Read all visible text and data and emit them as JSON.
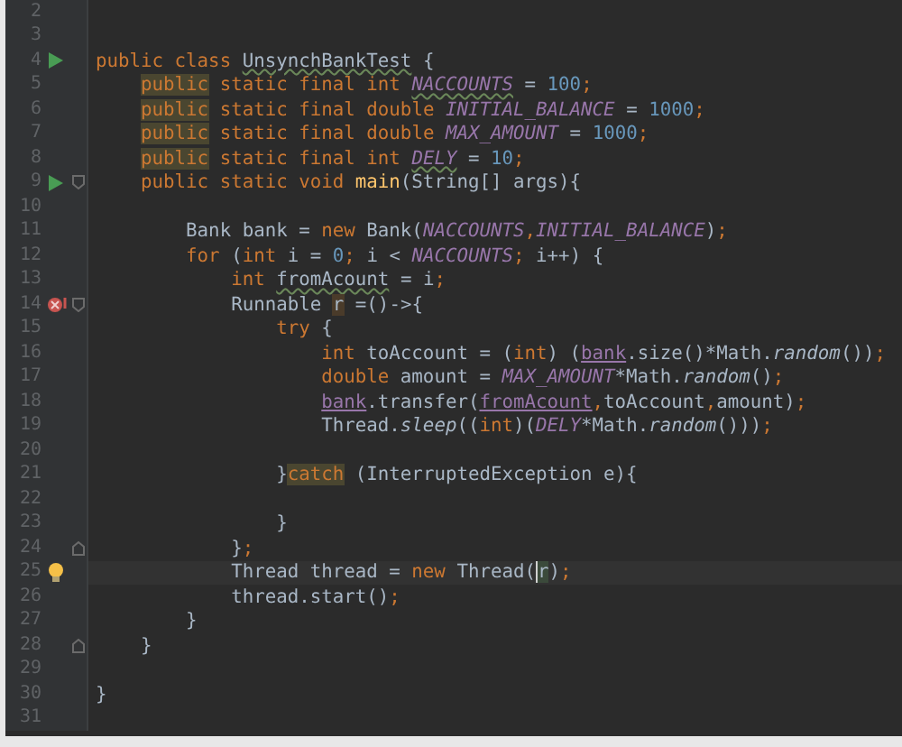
{
  "editor": {
    "lines": [
      {
        "number": "2"
      },
      {
        "number": "3"
      },
      {
        "number": "4",
        "gutter_icon": {
          "kind": "run"
        },
        "tokens": [
          {
            "text": "public class ",
            "kind": "keyword"
          },
          {
            "text": "UnsynchBankTest",
            "kind": "typo"
          },
          {
            "text": " {",
            "kind": "plain"
          }
        ]
      },
      {
        "number": "5",
        "tokens": [
          {
            "text": "    public",
            "kind": "keyword-highlight"
          },
          {
            "text": " static final int ",
            "kind": "keyword"
          },
          {
            "text": "NACCOUNTS",
            "kind": "constant-typo"
          },
          {
            "text": " = ",
            "kind": "plain"
          },
          {
            "text": "100",
            "kind": "number"
          },
          {
            "text": ";",
            "kind": "keyword"
          }
        ]
      },
      {
        "number": "6",
        "tokens": [
          {
            "text": "    public",
            "kind": "keyword-highlight"
          },
          {
            "text": " static final double ",
            "kind": "keyword"
          },
          {
            "text": "INITIAL_BALANCE",
            "kind": "constant"
          },
          {
            "text": " = ",
            "kind": "plain"
          },
          {
            "text": "1000",
            "kind": "number"
          },
          {
            "text": ";",
            "kind": "keyword"
          }
        ]
      },
      {
        "number": "7",
        "tokens": [
          {
            "text": "    public",
            "kind": "keyword-highlight"
          },
          {
            "text": " static final double ",
            "kind": "keyword"
          },
          {
            "text": "MAX_AMOUNT",
            "kind": "constant"
          },
          {
            "text": " = ",
            "kind": "plain"
          },
          {
            "text": "1000",
            "kind": "number"
          },
          {
            "text": ";",
            "kind": "keyword"
          }
        ]
      },
      {
        "number": "8",
        "tokens": [
          {
            "text": "    public",
            "kind": "keyword-highlight"
          },
          {
            "text": " static final int ",
            "kind": "keyword"
          },
          {
            "text": "DELY",
            "kind": "constant-typo"
          },
          {
            "text": " = ",
            "kind": "plain"
          },
          {
            "text": "10",
            "kind": "number"
          },
          {
            "text": ";",
            "kind": "keyword"
          }
        ]
      },
      {
        "number": "9",
        "gutter_icon": {
          "kind": "run"
        },
        "fold_marker": {
          "kind": "start"
        },
        "tokens": [
          {
            "text": "    public static void ",
            "kind": "keyword"
          },
          {
            "text": "main",
            "kind": "method"
          },
          {
            "text": "(String[] args){",
            "kind": "plain"
          }
        ]
      },
      {
        "number": "10"
      },
      {
        "number": "11",
        "tokens": [
          {
            "text": "        Bank bank = ",
            "kind": "plain"
          },
          {
            "text": "new ",
            "kind": "keyword"
          },
          {
            "text": "Bank(",
            "kind": "plain"
          },
          {
            "text": "NACCOUNTS",
            "kind": "constant"
          },
          {
            "text": ",",
            "kind": "keyword"
          },
          {
            "text": "INITIAL_BALANCE",
            "kind": "constant"
          },
          {
            "text": ")",
            "kind": "plain"
          },
          {
            "text": ";",
            "kind": "keyword"
          }
        ]
      },
      {
        "number": "12",
        "tokens": [
          {
            "text": "        for ",
            "kind": "keyword"
          },
          {
            "text": "(",
            "kind": "plain"
          },
          {
            "text": "int ",
            "kind": "keyword"
          },
          {
            "text": "i = ",
            "kind": "plain"
          },
          {
            "text": "0",
            "kind": "number"
          },
          {
            "text": "; ",
            "kind": "keyword"
          },
          {
            "text": "i < ",
            "kind": "plain"
          },
          {
            "text": "NACCOUNTS",
            "kind": "constant"
          },
          {
            "text": "; ",
            "kind": "keyword"
          },
          {
            "text": "i++) {",
            "kind": "plain"
          }
        ]
      },
      {
        "number": "13",
        "tokens": [
          {
            "text": "            int ",
            "kind": "keyword"
          },
          {
            "text": "fromAcount",
            "kind": "typo"
          },
          {
            "text": " = i",
            "kind": "plain"
          },
          {
            "text": ";",
            "kind": "keyword"
          }
        ]
      },
      {
        "number": "14",
        "gutter_icon": {
          "kind": "breakpoint"
        },
        "fold_marker": {
          "kind": "start"
        },
        "tokens": [
          {
            "text": "            Runnable ",
            "kind": "plain"
          },
          {
            "text": "r",
            "kind": "variable-highlight"
          },
          {
            "text": " =()->{",
            "kind": "plain"
          }
        ]
      },
      {
        "number": "15",
        "tokens": [
          {
            "text": "                try ",
            "kind": "keyword"
          },
          {
            "text": "{",
            "kind": "plain"
          }
        ]
      },
      {
        "number": "16",
        "tokens": [
          {
            "text": "                    int ",
            "kind": "keyword"
          },
          {
            "text": "toAccount = (",
            "kind": "plain"
          },
          {
            "text": "int",
            "kind": "keyword"
          },
          {
            "text": ") (",
            "kind": "plain"
          },
          {
            "text": "bank",
            "kind": "field"
          },
          {
            "text": ".size()*Math.",
            "kind": "plain"
          },
          {
            "text": "random",
            "kind": "static-method"
          },
          {
            "text": "())",
            "kind": "plain"
          },
          {
            "text": ";",
            "kind": "keyword"
          }
        ]
      },
      {
        "number": "17",
        "tokens": [
          {
            "text": "                    double ",
            "kind": "keyword"
          },
          {
            "text": "amount = ",
            "kind": "plain"
          },
          {
            "text": "MAX_AMOUNT",
            "kind": "constant"
          },
          {
            "text": "*Math.",
            "kind": "plain"
          },
          {
            "text": "random",
            "kind": "static-method"
          },
          {
            "text": "()",
            "kind": "plain"
          },
          {
            "text": ";",
            "kind": "keyword"
          }
        ]
      },
      {
        "number": "18",
        "tokens": [
          {
            "text": "                    bank",
            "kind": "field"
          },
          {
            "text": ".transfer(",
            "kind": "plain"
          },
          {
            "text": "fromAcount",
            "kind": "field"
          },
          {
            "text": ",",
            "kind": "keyword"
          },
          {
            "text": "toAccount",
            "kind": "plain"
          },
          {
            "text": ",",
            "kind": "keyword"
          },
          {
            "text": "amount)",
            "kind": "plain"
          },
          {
            "text": ";",
            "kind": "keyword"
          }
        ]
      },
      {
        "number": "19",
        "tokens": [
          {
            "text": "                    Thread.",
            "kind": "plain"
          },
          {
            "text": "sleep",
            "kind": "static-method"
          },
          {
            "text": "((",
            "kind": "plain"
          },
          {
            "text": "int",
            "kind": "keyword"
          },
          {
            "text": ")(",
            "kind": "plain"
          },
          {
            "text": "DELY",
            "kind": "constant"
          },
          {
            "text": "*Math.",
            "kind": "plain"
          },
          {
            "text": "random",
            "kind": "static-method"
          },
          {
            "text": "()))",
            "kind": "plain"
          },
          {
            "text": ";",
            "kind": "keyword"
          }
        ]
      },
      {
        "number": "20"
      },
      {
        "number": "21",
        "tokens": [
          {
            "text": "                }",
            "kind": "plain"
          },
          {
            "text": "catch",
            "kind": "keyword-highlight"
          },
          {
            "text": " (InterruptedException e){",
            "kind": "plain"
          }
        ]
      },
      {
        "number": "22"
      },
      {
        "number": "23",
        "tokens": [
          {
            "text": "                }",
            "kind": "plain"
          }
        ]
      },
      {
        "number": "24",
        "fold_marker": {
          "kind": "end"
        },
        "tokens": [
          {
            "text": "            }",
            "kind": "plain"
          },
          {
            "text": ";",
            "kind": "keyword"
          }
        ]
      },
      {
        "number": "25",
        "gutter_icon": {
          "kind": "bulb"
        },
        "current": true,
        "tokens": [
          {
            "text": "            Thread thread = ",
            "kind": "plain"
          },
          {
            "text": "new ",
            "kind": "keyword"
          },
          {
            "text": "Thread(",
            "kind": "plain"
          },
          {
            "text": "r",
            "kind": "caret"
          },
          {
            "text": ")",
            "kind": "plain"
          },
          {
            "text": ";",
            "kind": "keyword"
          }
        ]
      },
      {
        "number": "26",
        "tokens": [
          {
            "text": "            thread.start()",
            "kind": "plain"
          },
          {
            "text": ";",
            "kind": "keyword"
          }
        ]
      },
      {
        "number": "27",
        "tokens": [
          {
            "text": "        }",
            "kind": "plain"
          }
        ]
      },
      {
        "number": "28",
        "fold_marker": {
          "kind": "end"
        },
        "tokens": [
          {
            "text": "    }",
            "kind": "plain"
          }
        ]
      },
      {
        "number": "29"
      },
      {
        "number": "30",
        "tokens": [
          {
            "text": "}",
            "kind": "plain"
          }
        ]
      },
      {
        "number": "31"
      }
    ]
  }
}
